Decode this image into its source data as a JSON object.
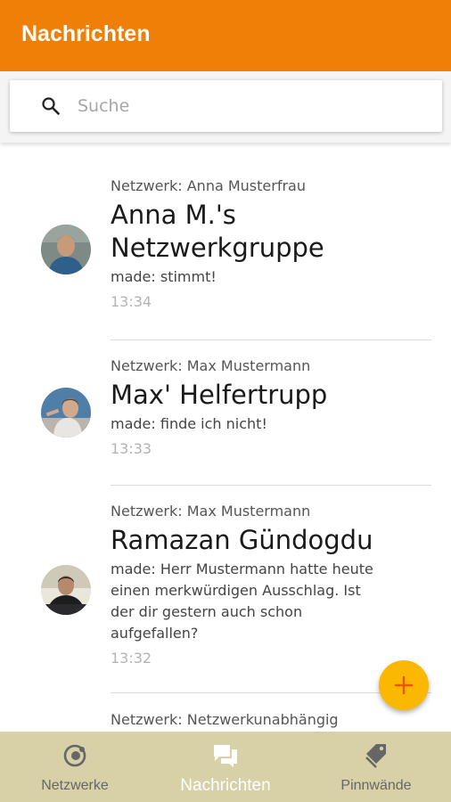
{
  "app_bar": {
    "title": "Nachrichten"
  },
  "search": {
    "placeholder": "Suche",
    "icon": "search-icon"
  },
  "conversations": [
    {
      "network": "Netzwerk: Anna Musterfrau",
      "name_lines": [
        "Anna M.'s",
        "Netzwerkgruppe"
      ],
      "message_lines": [
        "made: stimmt!"
      ],
      "time": "13:34"
    },
    {
      "network": "Netzwerk: Max Mustermann",
      "name_lines": [
        "Max' Helfertrupp"
      ],
      "message_lines": [
        "made: finde ich nicht!"
      ],
      "time": "13:33"
    },
    {
      "network": "Netzwerk: Max Mustermann",
      "name_lines": [
        "Ramazan Gündogdu"
      ],
      "message_lines": [
        "made: Herr Mustermann hatte heute",
        "einen merkwürdigen Ausschlag. Ist",
        "der dir gestern auch schon",
        "aufgefallen?"
      ],
      "time": "13:32"
    },
    {
      "network": "Netzwerk: Netzwerkunabhängig"
    }
  ],
  "fab": {
    "icon": "plus-icon"
  },
  "bottom_nav": [
    {
      "label": "Netzwerke",
      "icon": "network-icon",
      "active": false
    },
    {
      "label": "Nachrichten",
      "icon": "chat-icon",
      "active": true
    },
    {
      "label": "Pinnwände",
      "icon": "tag-icon",
      "active": false
    }
  ],
  "colors": {
    "app_bar": "#ef7f07",
    "fab": "#fbb800",
    "bottom_nav": "#d8d1a8"
  }
}
